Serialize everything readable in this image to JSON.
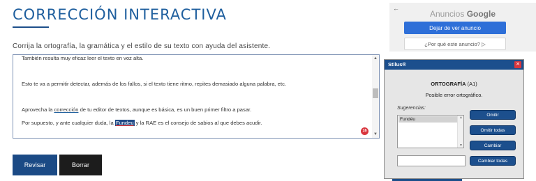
{
  "page": {
    "title": "CORRECCIÓN INTERACTIVA",
    "subtitle": "Corrija la ortografía, la gramática y el estilo de su texto con ayuda del asistente."
  },
  "editor": {
    "line1": "También resulta muy eficaz leer el texto en voz alta.",
    "line2": "Esto te va a permitir detectar, además de los fallos, si el texto tiene ritmo, repites demasiado alguna palabra, etc.",
    "line3_before": "Aprovecha la ",
    "line3_link": "corrección",
    "line3_after": " de tu editor de textos, aunque es básica, es un buen primer filtro a pasar.",
    "line4_before": "Por supuesto, y ante cualquier duda, la ",
    "line4_highlight": "Fundeu",
    "line4_after": " y la RAE es el consejo de sabios al que debes acudir.",
    "error_count": "16"
  },
  "buttons": {
    "revisar": "Revisar",
    "borrar": "Borrar"
  },
  "ad": {
    "back_arrow": "←",
    "label_prefix": "Anuncios",
    "label_brand": "Google",
    "stop_button": "Dejar de ver anuncio",
    "why_button": "¿Por qué este anuncio? ▷"
  },
  "dialog": {
    "title": "Stilus®",
    "close": "✕",
    "heading_bold": "ORTOGRAFÍA",
    "heading_code": " (A1)",
    "subheading": "Posible error ortográfico.",
    "suggestions_label": "Sugerencias:",
    "suggestions": [
      "Fundéu"
    ],
    "btn_omitir": "Omitir",
    "btn_omitir_todas": "Omitir todas",
    "btn_cambiar": "Cambiar",
    "btn_cambiar_todas": "Cambiar todas",
    "change_value": ""
  },
  "colors": {
    "accent_blue": "#1f5f9e",
    "button_dark": "#1c1c1c",
    "dialog_titlebar": "#1c4f8d",
    "error_red": "#d9363e",
    "ad_button": "#2e6fd8"
  }
}
